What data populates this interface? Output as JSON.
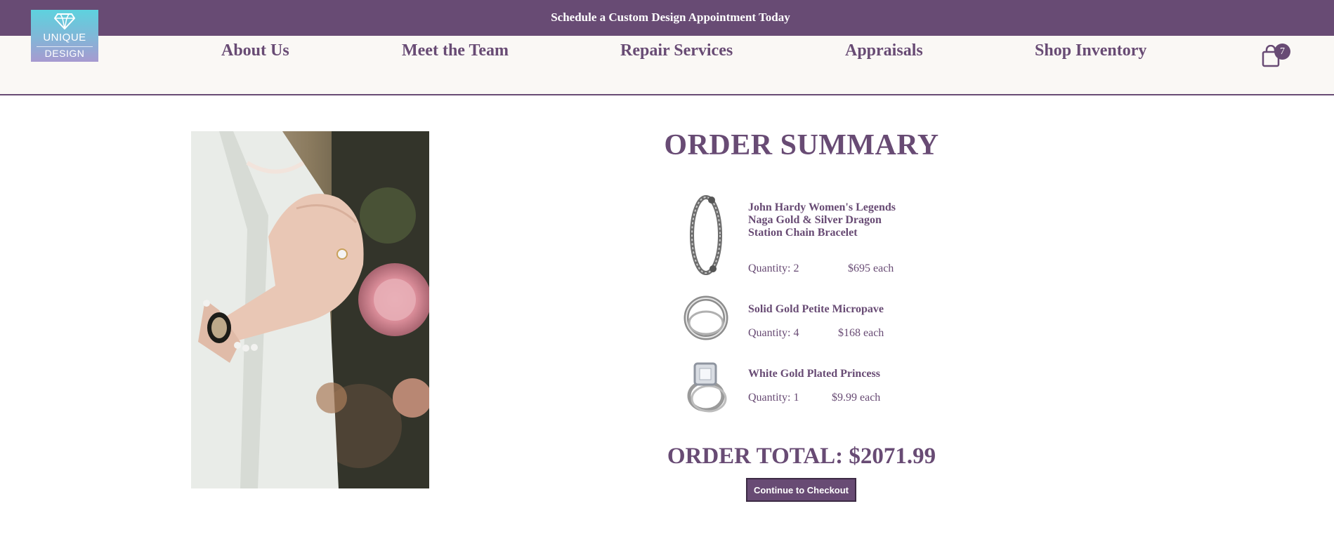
{
  "banner": {
    "text": "Schedule a Custom Design Appointment Today"
  },
  "logo": {
    "line1": "UNIQUE",
    "line2": "DESIGN"
  },
  "nav": {
    "items": [
      "About Us",
      "Meet the Team",
      "Repair Services",
      "Appraisals",
      "Shop Inventory"
    ]
  },
  "cart": {
    "count": "7",
    "icon": "shopping-bag-icon"
  },
  "order": {
    "title": "ORDER SUMMARY",
    "items": [
      {
        "name": "John Hardy Women's Legends Naga Gold & Silver Dragon Station Chain Bracelet",
        "quantity": "Quantity: 2",
        "price": "$695 each",
        "icon": "bracelet-image"
      },
      {
        "name": "Solid Gold Petite Micropave",
        "quantity": "Quantity: 4",
        "price": "$168 each",
        "icon": "band-ring-image"
      },
      {
        "name": "White Gold Plated Princess",
        "quantity": "Quantity: 1",
        "price": "$9.99 each",
        "icon": "engagement-ring-image"
      }
    ],
    "total": "ORDER TOTAL: $2071.99",
    "checkout_label": "Continue to Checkout"
  },
  "colors": {
    "brand_purple": "#684b74",
    "nav_background": "#faf8f5",
    "logo_gradient_top": "#5ed2de",
    "logo_gradient_bottom": "#a79ad0"
  }
}
